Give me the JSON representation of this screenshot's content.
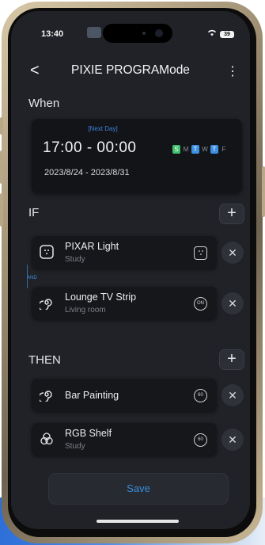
{
  "status_bar": {
    "time": "13:40",
    "battery": "39"
  },
  "header": {
    "back": "<",
    "title": "PIXIE PROGRAMode",
    "more": "⋮"
  },
  "when": {
    "title": "When",
    "next_day": "[Next Day]",
    "time_range": "17:00 - 00:00",
    "date_range": "2023/8/24 - 2023/8/31",
    "days": [
      {
        "label": "S",
        "state": "green"
      },
      {
        "label": "M",
        "state": "off"
      },
      {
        "label": "T",
        "state": "blue"
      },
      {
        "label": "W",
        "state": "off"
      },
      {
        "label": "T",
        "state": "blue"
      },
      {
        "label": "F",
        "state": "off"
      }
    ]
  },
  "if": {
    "title": "IF",
    "add_label": "+",
    "and_label": "AND",
    "items": [
      {
        "name": "PIXAR Light",
        "room": "Study",
        "state": "",
        "icon": "light-panel-icon"
      },
      {
        "name": "Lounge TV Strip",
        "room": "Living room",
        "state": "ON",
        "icon": "spiral-icon"
      }
    ]
  },
  "then": {
    "title": "THEN",
    "add_label": "+",
    "items": [
      {
        "name": "Bar Painting",
        "room": "",
        "state": "60",
        "icon": "spiral-icon"
      },
      {
        "name": "RGB Shelf",
        "room": "Study",
        "state": "60",
        "icon": "rgb-icon"
      }
    ]
  },
  "remove_label": "✕",
  "save_label": "Save",
  "colors": {
    "accent_blue": "#3d8fe0",
    "day_green": "#3fbf6b",
    "screen_bg": "#202227"
  }
}
